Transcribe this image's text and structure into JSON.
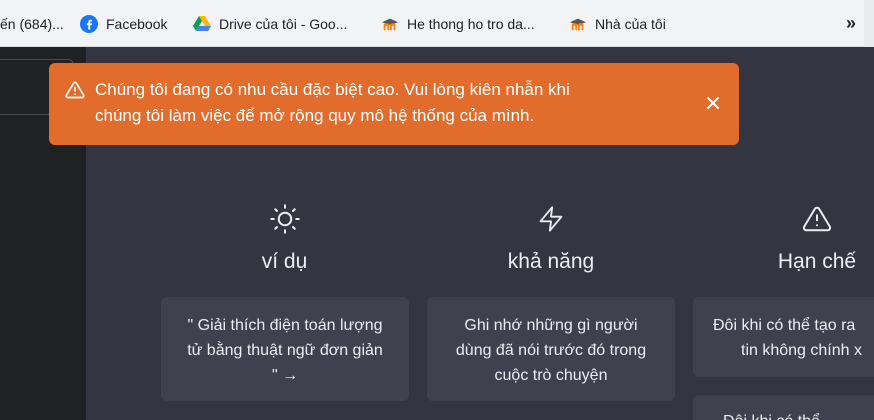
{
  "bookmarks": {
    "items": [
      {
        "label": "ến (684)...",
        "icon": "partial-icon"
      },
      {
        "label": "Facebook",
        "icon": "facebook-icon"
      },
      {
        "label": "Drive của tôi - Goo...",
        "icon": "google-drive-icon"
      },
      {
        "label": "He thong ho tro da...",
        "icon": "moodle-icon"
      },
      {
        "label": "Nhà của tôi",
        "icon": "moodle-icon"
      }
    ],
    "overflow_label": "»"
  },
  "banner": {
    "text_line1": "Chúng tôi đang có nhu cầu đặc biệt cao. Vui lòng kiên nhẫn khi",
    "text_line2": "chúng tôi làm việc để mở rộng quy mô hệ thống của mình.",
    "close_label": "×",
    "color": "#e16c2b"
  },
  "columns": [
    {
      "icon": "sun-icon",
      "title": "ví dụ",
      "cards": [
        {
          "lines": [
            "\" Giải thích điện toán lượng",
            "tử bằng thuật ngữ đơn giản",
            "\" →"
          ]
        }
      ]
    },
    {
      "icon": "lightning-icon",
      "title": "khả năng",
      "cards": [
        {
          "lines": [
            "Ghi nhớ những gì người",
            "dùng đã nói trước đó trong",
            "cuộc trò chuyện"
          ]
        }
      ]
    },
    {
      "icon": "warning-icon",
      "title": "Hạn chế",
      "cards": [
        {
          "lines": [
            "Đôi khi có thể tạo ra",
            "tin không chính x"
          ]
        },
        {
          "lines": [
            "Đôi khi có thể"
          ]
        }
      ]
    }
  ]
}
